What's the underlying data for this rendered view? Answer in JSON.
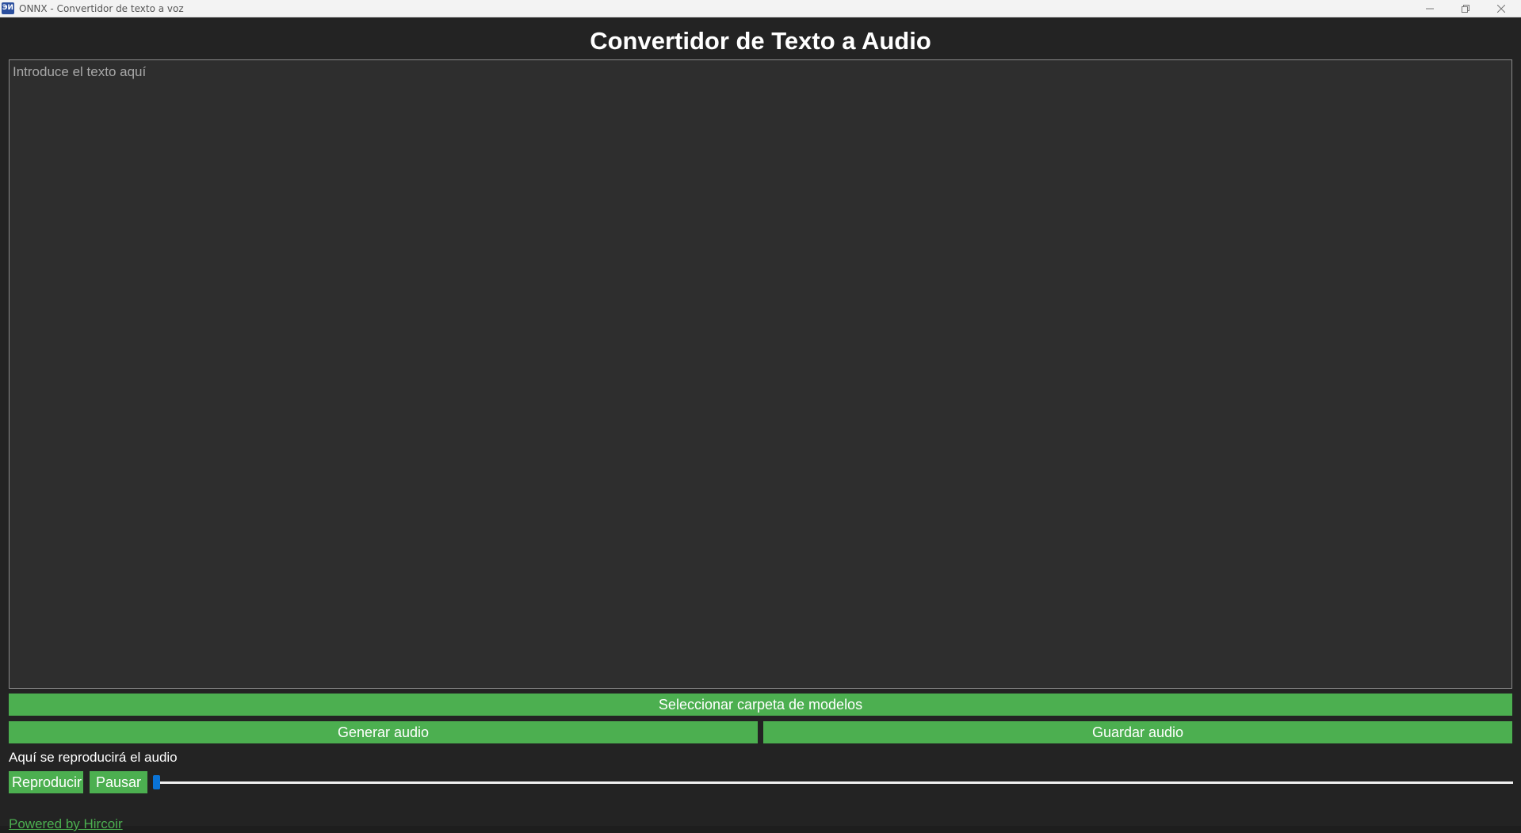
{
  "window": {
    "title": "ONNX - Convertidor de texto a voz",
    "icon_text": "ЭИ",
    "controls": [
      "minimize-icon",
      "restore-icon",
      "close-icon"
    ]
  },
  "app": {
    "heading": "Convertidor de Texto a Audio",
    "text_input": {
      "value": "",
      "placeholder": "Introduce el texto aquí"
    },
    "buttons": {
      "select_folder": "Seleccionar carpeta de modelos",
      "generate": "Generar audio",
      "save": "Guardar audio",
      "play": "Reproducir",
      "pause": "Pausar"
    },
    "audio_status": "Aquí se reproducirá el audio",
    "playback_progress": 0,
    "footer_link": "Powered by Hircoir"
  },
  "colors": {
    "accent": "#4caf50",
    "slider": "#0a73d6",
    "background": "#232323",
    "text_area_bg": "#2e2e2e"
  }
}
